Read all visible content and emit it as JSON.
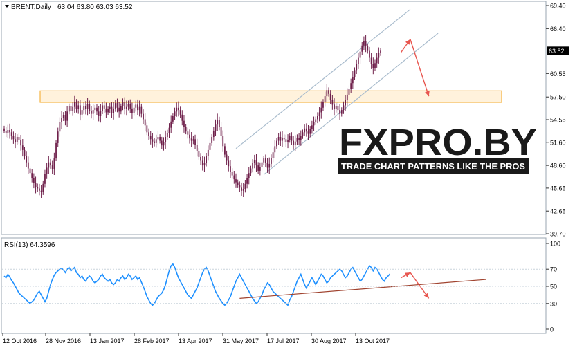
{
  "header": {
    "symbol": "BRENT,Daily",
    "ohlc": "63.04 63.80 63.03 63.52",
    "current_price": "63.52"
  },
  "watermark": {
    "brand": "FXPRO.BY",
    "tagline": "TRADE CHART PATTERNS LIKE THE PROS"
  },
  "rsi_label": "RSI(13) 64.3596",
  "colors": {
    "candle": "#6e1f4a",
    "rsi_line": "#1e90ff",
    "channel": "#a9bccd",
    "zone_border": "#f5b342",
    "zone_fill": "#fff2dc",
    "arrow": "#e8564f",
    "rsi_trend": "#a0432f",
    "grid": "#c9d3dc",
    "frame": "#9aa6b0",
    "price_tag_bg": "#000000",
    "price_tag_text": "#ffffff"
  },
  "chart_data": [
    {
      "type": "candlestick",
      "series_name": "BRENT Daily",
      "ylim": [
        39.7,
        69.4
      ],
      "y_ticks": [
        "69.40",
        "66.40",
        "63.52",
        "60.55",
        "57.50",
        "54.55",
        "51.60",
        "48.60",
        "45.65",
        "42.65",
        "39.70"
      ],
      "x_tick_labels": [
        "12 Oct 2016",
        "28 Nov 2016",
        "13 Jan 2017",
        "28 Feb 2017",
        "13 Apr 2017",
        "31 May 2017",
        "17 Jul 2017",
        "30 Aug 2017",
        "13 Oct 2017"
      ],
      "close": [
        53.1,
        52.8,
        53.2,
        52.9,
        52.4,
        52.0,
        51.6,
        52.3,
        51.9,
        51.2,
        50.6,
        49.8,
        49.0,
        48.2,
        47.6,
        46.9,
        46.3,
        45.8,
        45.6,
        45.3,
        45.1,
        46.2,
        47.5,
        48.3,
        49.0,
        48.6,
        48.1,
        49.5,
        51.5,
        53.0,
        54.2,
        54.8,
        55.1,
        54.4,
        55.6,
        56.3,
        55.7,
        56.2,
        56.8,
        55.9,
        56.4,
        55.2,
        55.8,
        56.3,
        55.9,
        56.6,
        55.7,
        55.3,
        55.8,
        56.1,
        55.6,
        55.0,
        55.7,
        56.4,
        56.0,
        55.5,
        55.9,
        56.2,
        55.4,
        56.0,
        56.7,
        56.1,
        55.6,
        56.3,
        56.8,
        55.9,
        56.2,
        56.6,
        56.0,
        55.4,
        56.1,
        56.5,
        55.8,
        56.2,
        55.3,
        54.6,
        53.8,
        52.9,
        52.4,
        52.0,
        51.7,
        51.5,
        52.0,
        52.3,
        51.8,
        51.2,
        51.6,
        52.3,
        52.8,
        53.5,
        54.3,
        55.0,
        55.6,
        56.1,
        55.8,
        55.2,
        54.4,
        53.6,
        53.0,
        52.6,
        52.1,
        51.8,
        52.0,
        51.3,
        50.5,
        49.7,
        49.2,
        48.6,
        48.9,
        49.8,
        50.6,
        51.5,
        52.3,
        53.1,
        53.9,
        54.5,
        53.6,
        52.4,
        51.1,
        50.0,
        49.2,
        48.5,
        47.8,
        47.3,
        46.8,
        46.4,
        46.0,
        45.7,
        45.3,
        45.5,
        46.2,
        46.9,
        47.6,
        48.2,
        48.9,
        49.3,
        48.6,
        47.9,
        48.4,
        49.0,
        49.5,
        48.9,
        48.3,
        48.8,
        49.6,
        50.3,
        51.1,
        51.8,
        52.3,
        51.8,
        52.2,
        52.0,
        51.6,
        51.9,
        52.4,
        51.8,
        51.3,
        51.7,
        52.2,
        51.9,
        52.4,
        52.9,
        53.4,
        53.0,
        52.7,
        53.3,
        53.8,
        54.2,
        54.6,
        55.0,
        55.5,
        56.1,
        56.8,
        57.6,
        58.4,
        57.9,
        57.1,
        56.5,
        55.9,
        56.3,
        55.8,
        55.3,
        55.8,
        56.4,
        57.1,
        57.8,
        58.6,
        59.3,
        60.1,
        61.0,
        61.8,
        62.6,
        63.4,
        64.2,
        64.8,
        64.1,
        63.5,
        62.6,
        61.8,
        61.3,
        61.9,
        62.6,
        63.2,
        63.52
      ],
      "annotations": {
        "resistance_zone": [
          56.8,
          58.3
        ],
        "upper_channel": {
          "start": [
            125,
            50.8
          ],
          "end": [
            219,
            68.9
          ]
        },
        "lower_channel": {
          "start": [
            140,
            47.4
          ],
          "end": [
            234,
            65.8
          ]
        },
        "forecast_arrow_up": {
          "from": [
            214,
            63.3
          ],
          "to": [
            219,
            65.0
          ]
        },
        "forecast_arrow_down": {
          "from": [
            219,
            65.0
          ],
          "to": [
            229,
            57.6
          ]
        }
      }
    },
    {
      "type": "line",
      "series_name": "RSI(13)",
      "ylim": [
        0,
        100
      ],
      "y_ticks": [
        "100",
        "70",
        "50",
        "30",
        "0"
      ],
      "values": [
        62,
        60,
        64,
        61,
        57,
        54,
        50,
        46,
        42,
        40,
        38,
        36,
        34,
        32,
        30,
        32,
        34,
        38,
        42,
        44,
        40,
        36,
        32,
        36,
        44,
        52,
        58,
        63,
        66,
        68,
        70,
        71,
        69,
        66,
        70,
        72,
        68,
        70,
        72,
        66,
        64,
        60,
        62,
        58,
        56,
        60,
        62,
        60,
        56,
        54,
        56,
        58,
        62,
        64,
        60,
        58,
        56,
        58,
        54,
        52,
        54,
        58,
        56,
        60,
        62,
        58,
        60,
        64,
        62,
        58,
        60,
        62,
        58,
        60,
        55,
        50,
        44,
        38,
        34,
        30,
        28,
        30,
        34,
        38,
        40,
        42,
        46,
        52,
        60,
        68,
        74,
        76,
        72,
        66,
        60,
        56,
        52,
        48,
        44,
        40,
        38,
        36,
        40,
        44,
        48,
        54,
        60,
        66,
        70,
        72,
        68,
        62,
        56,
        50,
        44,
        40,
        36,
        33,
        30,
        28,
        30,
        34,
        38,
        44,
        50,
        56,
        60,
        64,
        60,
        56,
        52,
        48,
        44,
        40,
        36,
        33,
        30,
        32,
        36,
        40,
        46,
        50,
        54,
        52,
        48,
        44,
        42,
        40,
        38,
        36,
        34,
        32,
        30,
        28,
        34,
        38,
        44,
        50,
        56,
        60,
        64,
        58,
        52,
        48,
        52,
        56,
        60,
        56,
        52,
        56,
        60,
        64,
        62,
        58,
        54,
        56,
        60,
        62,
        64,
        66,
        68,
        70,
        68,
        64,
        60,
        62,
        66,
        70,
        72,
        68,
        64,
        60,
        56,
        58,
        62,
        66,
        70,
        74,
        72,
        68,
        72,
        70,
        66,
        62,
        58,
        56,
        60,
        62,
        64.36
      ],
      "annotations": {
        "rsi_trend_line": {
          "start": [
            127,
            36
          ],
          "end": [
            260,
            58
          ]
        },
        "forecast_arrow_up": {
          "from": [
            214,
            60.0
          ],
          "to": [
            219,
            66.0
          ]
        },
        "forecast_arrow_down": {
          "from": [
            219,
            66.0
          ],
          "to": [
            229,
            36.0
          ]
        }
      }
    }
  ]
}
